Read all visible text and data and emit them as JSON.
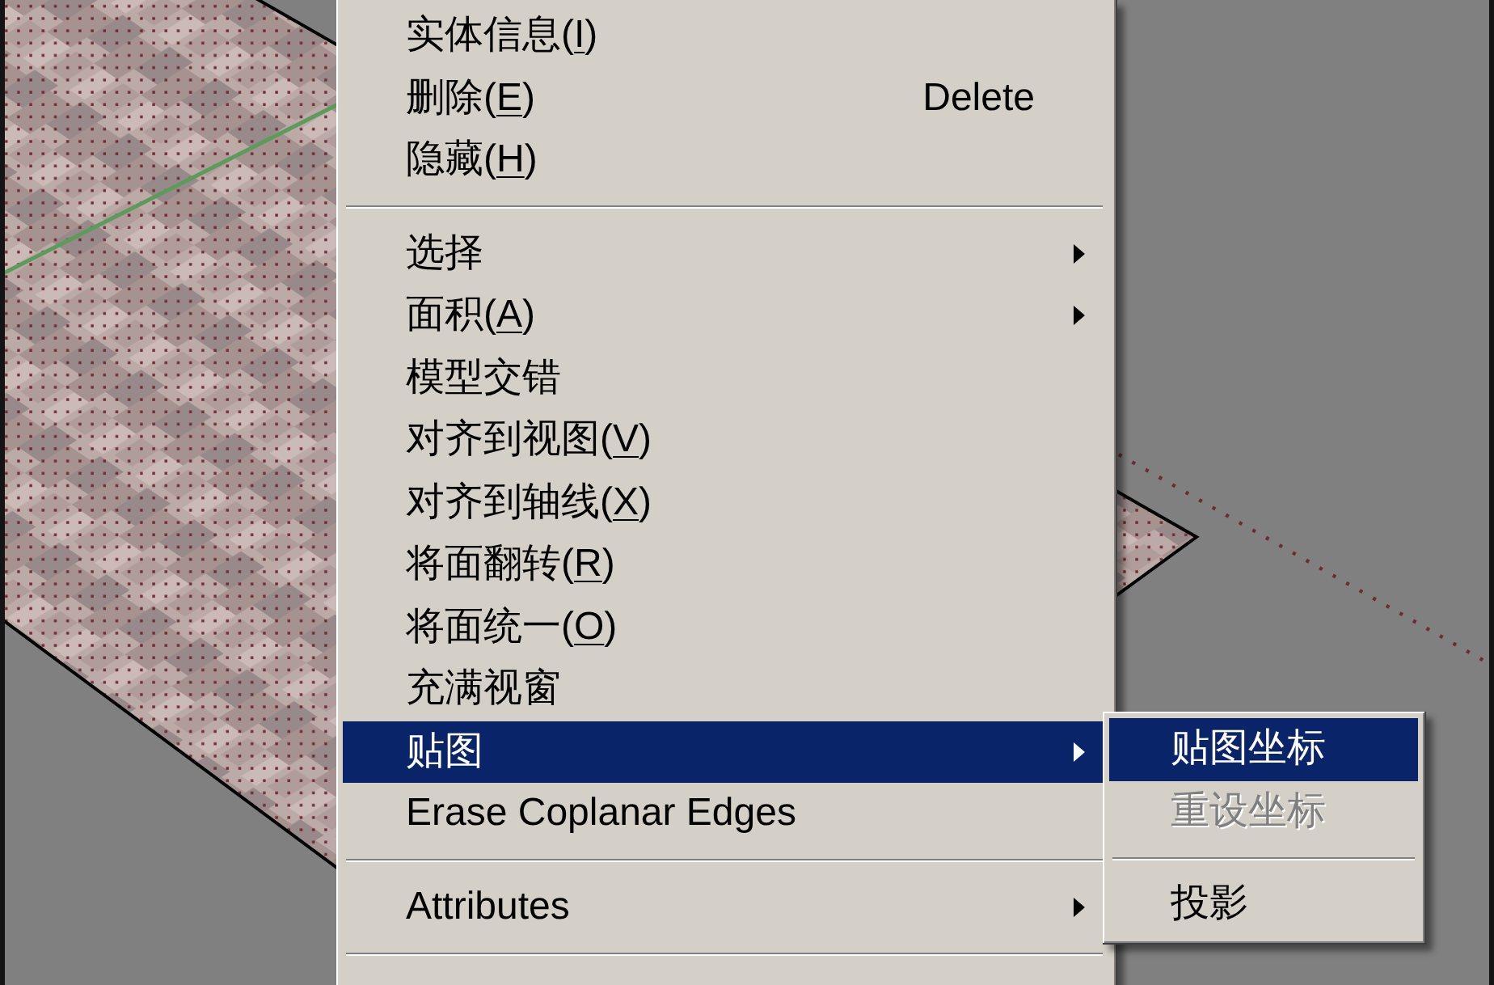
{
  "context_menu": {
    "items": [
      {
        "kind": "item",
        "label": "实体信息(",
        "access_key": "I",
        "label_end": ")",
        "submenu": false,
        "selected": false
      },
      {
        "kind": "item",
        "label": "删除(",
        "access_key": "E",
        "label_end": ")",
        "shortcut": "Delete",
        "submenu": false,
        "selected": false
      },
      {
        "kind": "item",
        "label": "隐藏(",
        "access_key": "H",
        "label_end": ")",
        "submenu": false,
        "selected": false
      },
      {
        "kind": "separator"
      },
      {
        "kind": "item",
        "label": "选择",
        "submenu": true,
        "selected": false
      },
      {
        "kind": "item",
        "label": "面积(",
        "access_key": "A",
        "label_end": ")",
        "submenu": true,
        "selected": false
      },
      {
        "kind": "item",
        "label": "模型交错",
        "submenu": false,
        "selected": false
      },
      {
        "kind": "item",
        "label": "对齐到视图(",
        "access_key": "V",
        "label_end": ")",
        "submenu": false,
        "selected": false
      },
      {
        "kind": "item",
        "label": "对齐到轴线(",
        "access_key": "X",
        "label_end": ")",
        "submenu": false,
        "selected": false
      },
      {
        "kind": "item",
        "label": "将面翻转(",
        "access_key": "R",
        "label_end": ")",
        "submenu": false,
        "selected": false
      },
      {
        "kind": "item",
        "label": "将面统一(",
        "access_key": "O",
        "label_end": ")",
        "submenu": false,
        "selected": false
      },
      {
        "kind": "item",
        "label": "充满视窗",
        "submenu": false,
        "selected": false
      },
      {
        "kind": "item",
        "label": "贴图",
        "submenu": true,
        "selected": true
      },
      {
        "kind": "item",
        "label": "Erase Coplanar Edges",
        "submenu": false,
        "selected": false
      },
      {
        "kind": "separator"
      },
      {
        "kind": "item",
        "label": "Attributes",
        "submenu": true,
        "selected": false
      },
      {
        "kind": "separator"
      }
    ]
  },
  "submenu": {
    "items": [
      {
        "kind": "item",
        "label": "贴图坐标",
        "selected": true,
        "disabled": false
      },
      {
        "kind": "item",
        "label": "重设坐标",
        "selected": false,
        "disabled": true
      },
      {
        "kind": "separator"
      },
      {
        "kind": "item",
        "label": "投影",
        "selected": false,
        "disabled": false
      }
    ]
  }
}
